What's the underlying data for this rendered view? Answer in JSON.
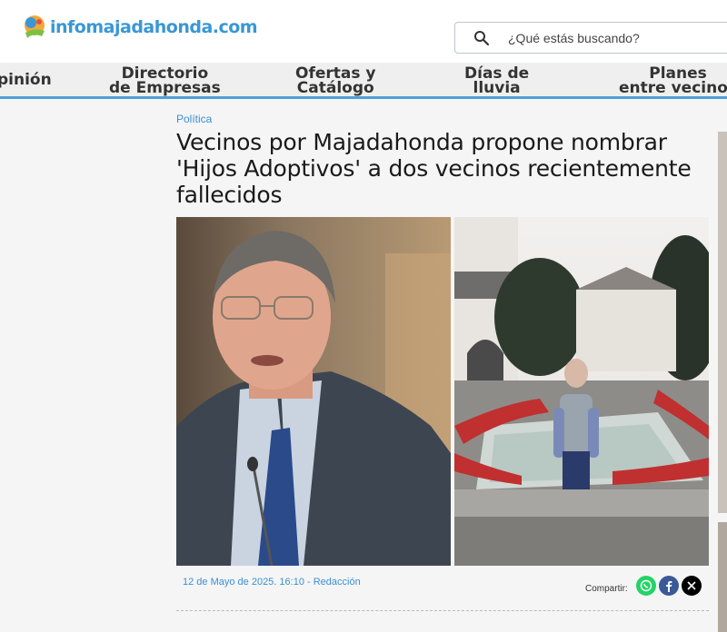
{
  "header": {
    "logo_prefix": "info",
    "logo_suffix": "majadahonda.com",
    "search_placeholder": "¿Qué estás buscando?"
  },
  "nav": {
    "items": [
      {
        "line1": "pinión",
        "line2": ""
      },
      {
        "line1": "Directorio",
        "line2": "de Empresas"
      },
      {
        "line1": "Ofertas y",
        "line2": "Catálogo"
      },
      {
        "line1": "Días de",
        "line2": "lluvia"
      },
      {
        "line1": "Planes",
        "line2": "entre vecinos"
      }
    ]
  },
  "article": {
    "category": "Política",
    "title": "Vecinos por Majadahonda propone nombrar 'Hijos Adoptivos' a dos vecinos recientemente fallecidos",
    "date_author": "12 de Mayo de 2025. 16:10 - Redacción",
    "share_label": "Compartir:"
  },
  "colors": {
    "accent": "#3a97d4",
    "nav_border": "#4f9fdc",
    "whatsapp": "#25d366",
    "facebook": "#3b5998",
    "x": "#000000"
  },
  "icons": [
    "search-icon",
    "whatsapp-icon",
    "facebook-icon",
    "x-icon"
  ]
}
